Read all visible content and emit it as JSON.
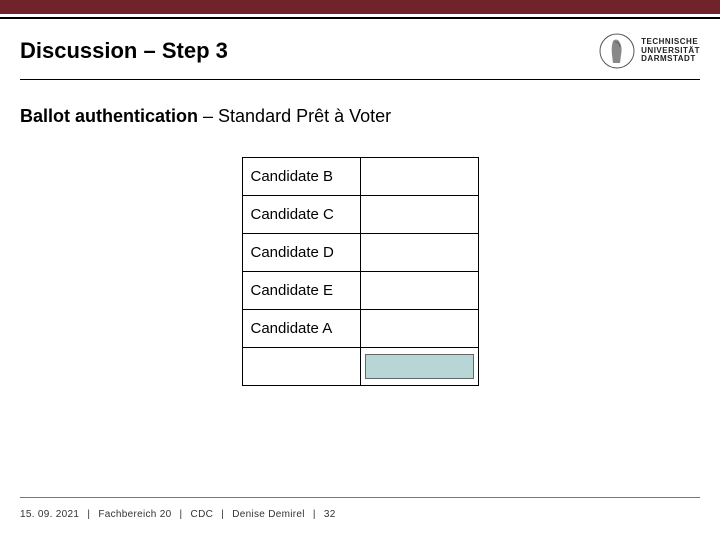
{
  "header": {
    "title": "Discussion – Step 3",
    "org_line1": "TECHNISCHE",
    "org_line2": "UNIVERSITÄT",
    "org_line3": "DARMSTADT"
  },
  "section": {
    "bold_part": "Ballot authentication",
    "rest_part": " – Standard Prêt à Voter"
  },
  "ballot": {
    "rows": [
      {
        "name": "Candidate B"
      },
      {
        "name": "Candidate C"
      },
      {
        "name": "Candidate D"
      },
      {
        "name": "Candidate E"
      },
      {
        "name": "Candidate A"
      }
    ]
  },
  "footer": {
    "date": "15. 09. 2021",
    "dept": "Fachbereich 20",
    "unit": "CDC",
    "author": "Denise Demirel",
    "page": "32",
    "sep": "|"
  },
  "colors": {
    "accent_bar": "#70232b",
    "shade": "#b9d6d6"
  }
}
